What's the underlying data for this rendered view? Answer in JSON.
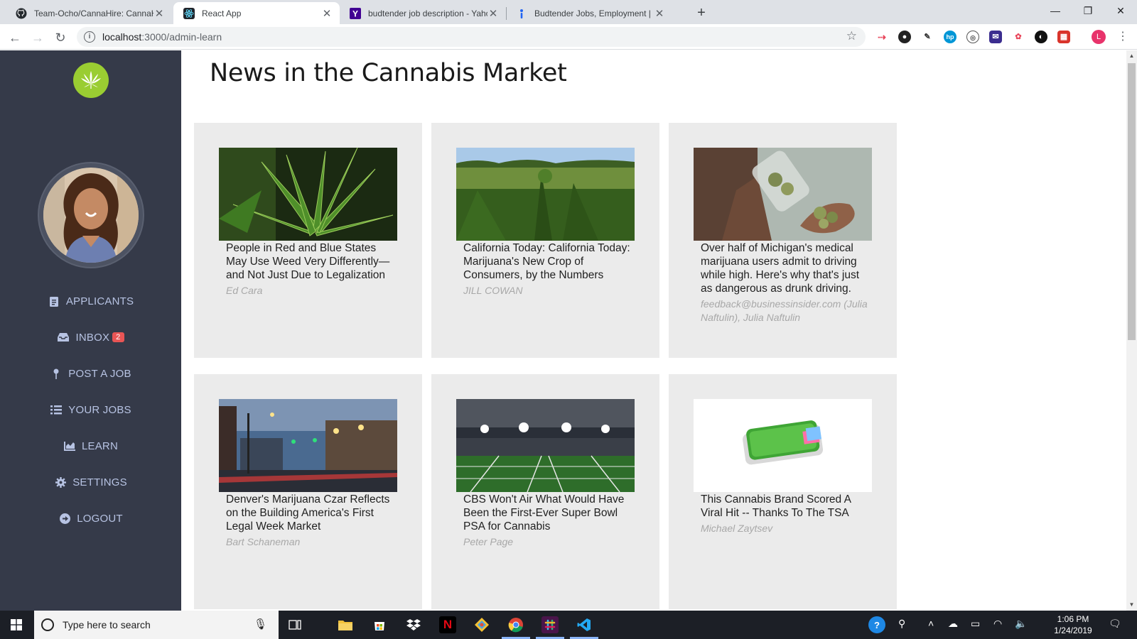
{
  "browser": {
    "tabs": [
      {
        "title": "Team-Ocho/CannaHire: CannaHi",
        "active": false
      },
      {
        "title": "React App",
        "active": true
      },
      {
        "title": "budtender job description - Yahc",
        "active": false
      },
      {
        "title": "Budtender Jobs, Employment | In",
        "active": false
      }
    ],
    "new_tab": "+",
    "url_host": "localhost",
    "url_path": ":3000/admin-learn",
    "profile_initial": "L",
    "window_controls": {
      "minimize": "—",
      "restore": "❐",
      "close": "✕"
    }
  },
  "sidebar": {
    "nav": [
      {
        "label": "APPLICANTS",
        "icon": "clipboard-icon"
      },
      {
        "label": "INBOX",
        "icon": "inbox-icon",
        "badge": "2"
      },
      {
        "label": "POST A JOB",
        "icon": "pin-icon"
      },
      {
        "label": "YOUR JOBS",
        "icon": "list-icon"
      },
      {
        "label": "LEARN",
        "icon": "chart-icon"
      },
      {
        "label": "SETTINGS",
        "icon": "gear-icon"
      },
      {
        "label": "LOGOUT",
        "icon": "logout-icon"
      }
    ]
  },
  "main": {
    "title": "News in the Cannabis Market",
    "articles": [
      {
        "title": "People in Red and Blue States May Use Weed Very Differently—and Not Just Due to Legalization",
        "author": "Ed Cara",
        "image": "cannabis-leaf-photo"
      },
      {
        "title": "California Today: California Today: Marijuana's New Crop of Consumers, by the Numbers",
        "author": "JILL COWAN",
        "image": "cannabis-field-photo"
      },
      {
        "title": "Over half of Michigan's medical marijuana users admit to driving while high. Here's why that's just as dangerous as drunk driving.",
        "author": "feedback@businessinsider.com (Julia Naftulin), Julia Naftulin",
        "image": "jar-of-buds-photo"
      },
      {
        "title": "Denver's Marijuana Czar Reflects on the Building America's First Legal Week Market",
        "author": "Bart Schaneman",
        "image": "city-street-photo"
      },
      {
        "title": "CBS Won't Air What Would Have Been the First-Ever Super Bowl PSA for Cannabis",
        "author": "Peter Page",
        "image": "football-stadium-photo"
      },
      {
        "title": "This Cannabis Brand Scored A Viral Hit -- Thanks To The TSA",
        "author": "Michael Zaytsev",
        "image": "cannabis-is-legal-case-photo"
      }
    ]
  },
  "taskbar": {
    "search_placeholder": "Type here to search",
    "time": "1:06 PM",
    "date": "1/24/2019"
  },
  "colors": {
    "sidebar_bg": "#353a49",
    "sidebar_text": "#b7c3e3",
    "card_bg": "#ebebeb",
    "author_text": "#a8a8a8",
    "badge": "#e95555",
    "logo": "#9acd32"
  }
}
